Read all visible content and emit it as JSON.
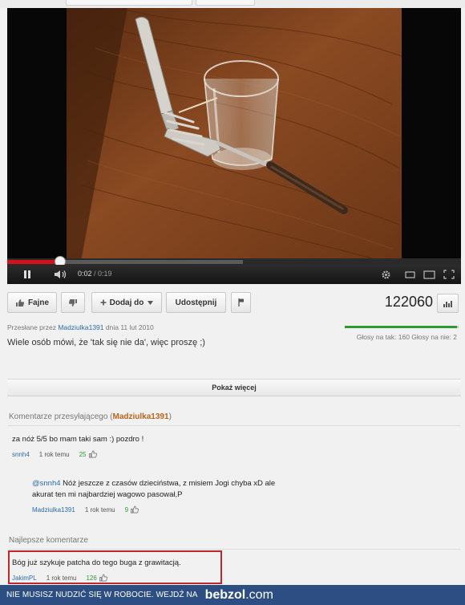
{
  "player": {
    "current_time": "0:02",
    "time_separator": " / ",
    "duration": "0:19",
    "progress_played": 0.115,
    "progress_loaded": 0.52
  },
  "actions": {
    "like_label": "Fajne",
    "add_label": "Dodaj do",
    "share_label": "Udostępnij",
    "views": "122060"
  },
  "video_info": {
    "uploaded_prefix": "Przesłane przez",
    "uploader": "Madziulka1391",
    "uploaded_date": "dnia 11 lut 2010",
    "description": "Wiele osób mówi, że 'tak się nie da', więc proszę ;)",
    "likes_text": "Głosy na tak: 160 Głosy na nie: 2",
    "like_ratio": 0.988
  },
  "show_more": "Pokaż więcej",
  "uploader_comments": {
    "heading": "Komentarze przesyłającego (",
    "heading_user": "Madziulka1391",
    "heading_close": ")",
    "items": [
      {
        "text": "za nóż 5/5 bo mam taki sam :) pozdro !",
        "author": "snnh4",
        "ago": "1 rok temu",
        "score": "25"
      },
      {
        "mention": "@snnh4",
        "text_line1": " Nóż jeszcze z czasów dzieciństwa, z misiem Jogi chyba xD ale",
        "text_line2": "akurat ten mi najbardziej wagowo pasował,P",
        "author": "Madziulka1391",
        "ago": "1 rok temu",
        "score": "9"
      }
    ]
  },
  "best_comments": {
    "heading": "Najlepsze komentarze",
    "items": [
      {
        "text": "Bóg już szykuje patcha do tego buga z grawitacją.",
        "author": "JakimPL",
        "ago": "1 rok temu",
        "score": "126"
      }
    ]
  },
  "footer": {
    "message": "NIE MUSISZ NUDZIĆ SIĘ W ROBOCIE. WEJDŹ NA",
    "logo_main": "bebzol",
    "logo_domain": ".com"
  },
  "colors": {
    "progress_red": "#d3131b",
    "link_blue": "#2a6bb3",
    "score_green": "#2e9b2e",
    "highlight_red": "#c0272d",
    "footer_blue": "#2d4e82"
  }
}
